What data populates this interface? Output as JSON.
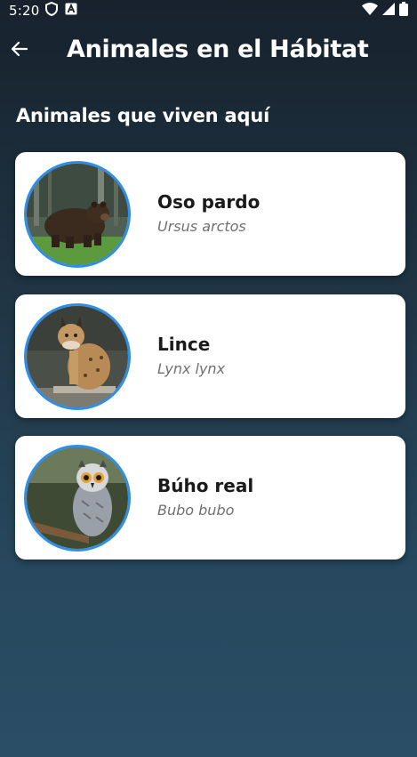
{
  "status_bar": {
    "time": "5:20",
    "left_icons": [
      "shield-icon",
      "a-icon"
    ],
    "right_icons": [
      "wifi-icon",
      "signal-icon",
      "battery-icon"
    ]
  },
  "app_bar": {
    "back_icon": "arrow-left-icon",
    "title": "Animales en el Hábitat"
  },
  "section": {
    "title": "Animales que viven aquí"
  },
  "animals": [
    {
      "common_name": "Oso pardo",
      "scientific_name": "Ursus arctos",
      "photo": "brown-bear-photo"
    },
    {
      "common_name": "Lince",
      "scientific_name": "Lynx lynx",
      "photo": "lynx-photo"
    },
    {
      "common_name": "Búho real",
      "scientific_name": "Bubo bubo",
      "photo": "owl-photo"
    }
  ],
  "colors": {
    "background_top": "#17222d",
    "background_bottom": "#2a4e66",
    "card": "#ffffff",
    "avatar_border": "#2e8ee8",
    "title_text": "#1a1a1a",
    "subtitle_text": "#707070"
  }
}
